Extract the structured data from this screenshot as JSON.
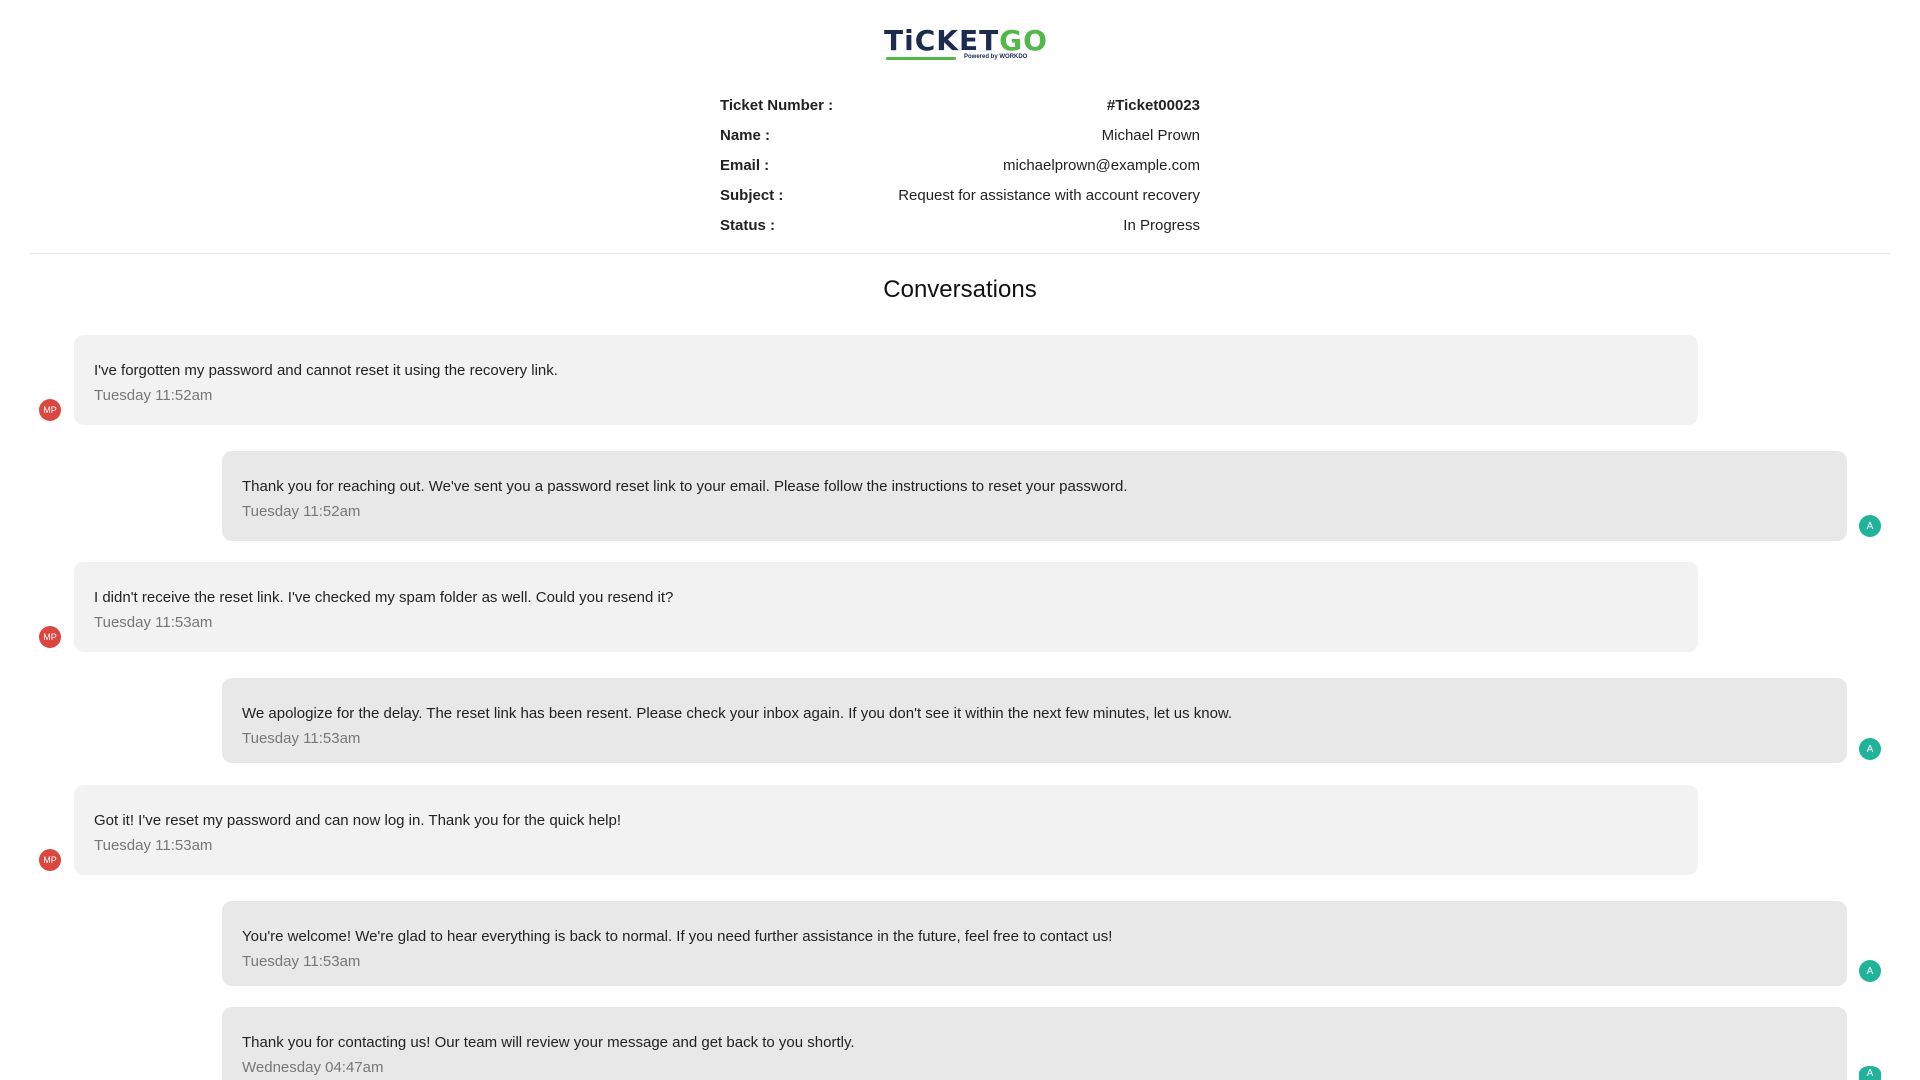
{
  "logo": {
    "word_main": "TiCKET",
    "word_accent": "GO",
    "powered": "Powered by WORKDO"
  },
  "ticket": {
    "fields": [
      {
        "label": "Ticket Number :",
        "value": "#Ticket00023"
      },
      {
        "label": "Name :",
        "value": "Michael Prown"
      },
      {
        "label": "Email :",
        "value": "michaelprown@example.com"
      },
      {
        "label": "Subject :",
        "value": "Request for assistance with account recovery"
      },
      {
        "label": "Status :",
        "value": "In Progress"
      }
    ]
  },
  "conversations": {
    "title": "Conversations",
    "messages": [
      {
        "from": "user",
        "avatar": "MP",
        "text": "I've forgotten my password and cannot reset it using the recovery link.",
        "time": "Tuesday 11:52am"
      },
      {
        "from": "agent",
        "avatar": "A",
        "text": "Thank you for reaching out. We've sent you a password reset link to your email. Please follow the instructions to reset your password.",
        "time": "Tuesday 11:52am"
      },
      {
        "from": "user",
        "avatar": "MP",
        "text": "I didn't receive the reset link. I've checked my spam folder as well. Could you resend it?",
        "time": "Tuesday 11:53am"
      },
      {
        "from": "agent",
        "avatar": "A",
        "text": "We apologize for the delay. The reset link has been resent. Please check your inbox again. If you don't see it within the next few minutes, let us know.",
        "time": "Tuesday 11:53am"
      },
      {
        "from": "user",
        "avatar": "MP",
        "text": "Got it! I've reset my password and can now log in. Thank you for the quick help!",
        "time": "Tuesday 11:53am"
      },
      {
        "from": "agent",
        "avatar": "A",
        "text": "You're welcome! We're glad to hear everything is back to normal. If you need further assistance in the future, feel free to contact us!",
        "time": "Tuesday 11:53am"
      },
      {
        "from": "agent",
        "avatar": "A",
        "text": "Thank you for contacting us! Our team will review your message and get back to you shortly.",
        "time": "Wednesday 04:47am"
      }
    ]
  },
  "colors": {
    "brand_dark": "#1d2b4f",
    "brand_green": "#52b848",
    "user_avatar": "#d9473f",
    "agent_avatar": "#21b39a"
  }
}
